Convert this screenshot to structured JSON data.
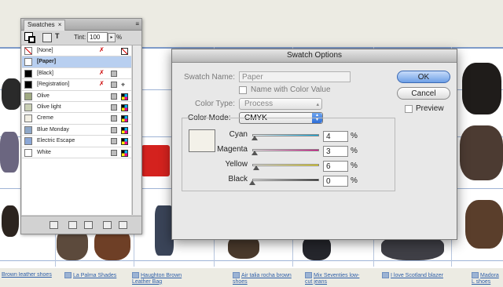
{
  "swatches_panel": {
    "tab_label": "Swatches",
    "close_glyph": "×",
    "menu_glyph": "≡",
    "tint_label": "Tint:",
    "tint_value": "100",
    "tint_arrow": "▸",
    "tint_unit": "%",
    "tool_text_glyph": "T",
    "rows": [
      {
        "name": "[None]",
        "color": "#ffffff",
        "none": true
      },
      {
        "name": "[Paper]",
        "color": "#ffffff",
        "selected": true
      },
      {
        "name": "[Black]",
        "color": "#000000"
      },
      {
        "name": "[Registration]",
        "color": "#000000"
      },
      {
        "name": "Olive",
        "color": "#9fa982"
      },
      {
        "name": "Olive light",
        "color": "#c9cfb5"
      },
      {
        "name": "Creme",
        "color": "#f2efe4"
      },
      {
        "name": "Blue Monday",
        "color": "#8ea7c7"
      },
      {
        "name": "Electric Escape",
        "color": "#8ba7d6"
      },
      {
        "name": "White",
        "color": "#ffffff"
      }
    ]
  },
  "dialog": {
    "title": "Swatch Options",
    "swatch_name_label": "Swatch Name:",
    "swatch_name_value": "Paper",
    "name_with_color_label": "Name with Color Value",
    "color_type_label": "Color Type:",
    "color_type_value": "Process",
    "color_mode_label": "Color Mode:",
    "color_mode_value": "CMYK",
    "preview_color": "#f3f1e9",
    "channels": [
      {
        "label": "Cyan",
        "value": "4",
        "value_fraction": 0.04,
        "track_from": "#ffffff",
        "track_to": "#00a8e0"
      },
      {
        "label": "Magenta",
        "value": "3",
        "value_fraction": 0.03,
        "track_from": "#ffffff",
        "track_to": "#e0008a"
      },
      {
        "label": "Yellow",
        "value": "6",
        "value_fraction": 0.06,
        "track_from": "#ffffff",
        "track_to": "#ffe800"
      },
      {
        "label": "Black",
        "value": "0",
        "value_fraction": 0.0,
        "track_from": "#ffffff",
        "track_to": "#000000"
      }
    ],
    "percent_sign": "%",
    "ok_label": "OK",
    "cancel_label": "Cancel",
    "preview_label": "Preview"
  },
  "captions": [
    "Brown leather shoes",
    "La Palma Shades",
    "Haughton Brown Leather Bag",
    "Air talia rocha brown shoes",
    "Mix Seventies low-cut jeans",
    "I love Scotland blazer",
    "Madora L shoes"
  ],
  "accent_color": "#3b78d8"
}
